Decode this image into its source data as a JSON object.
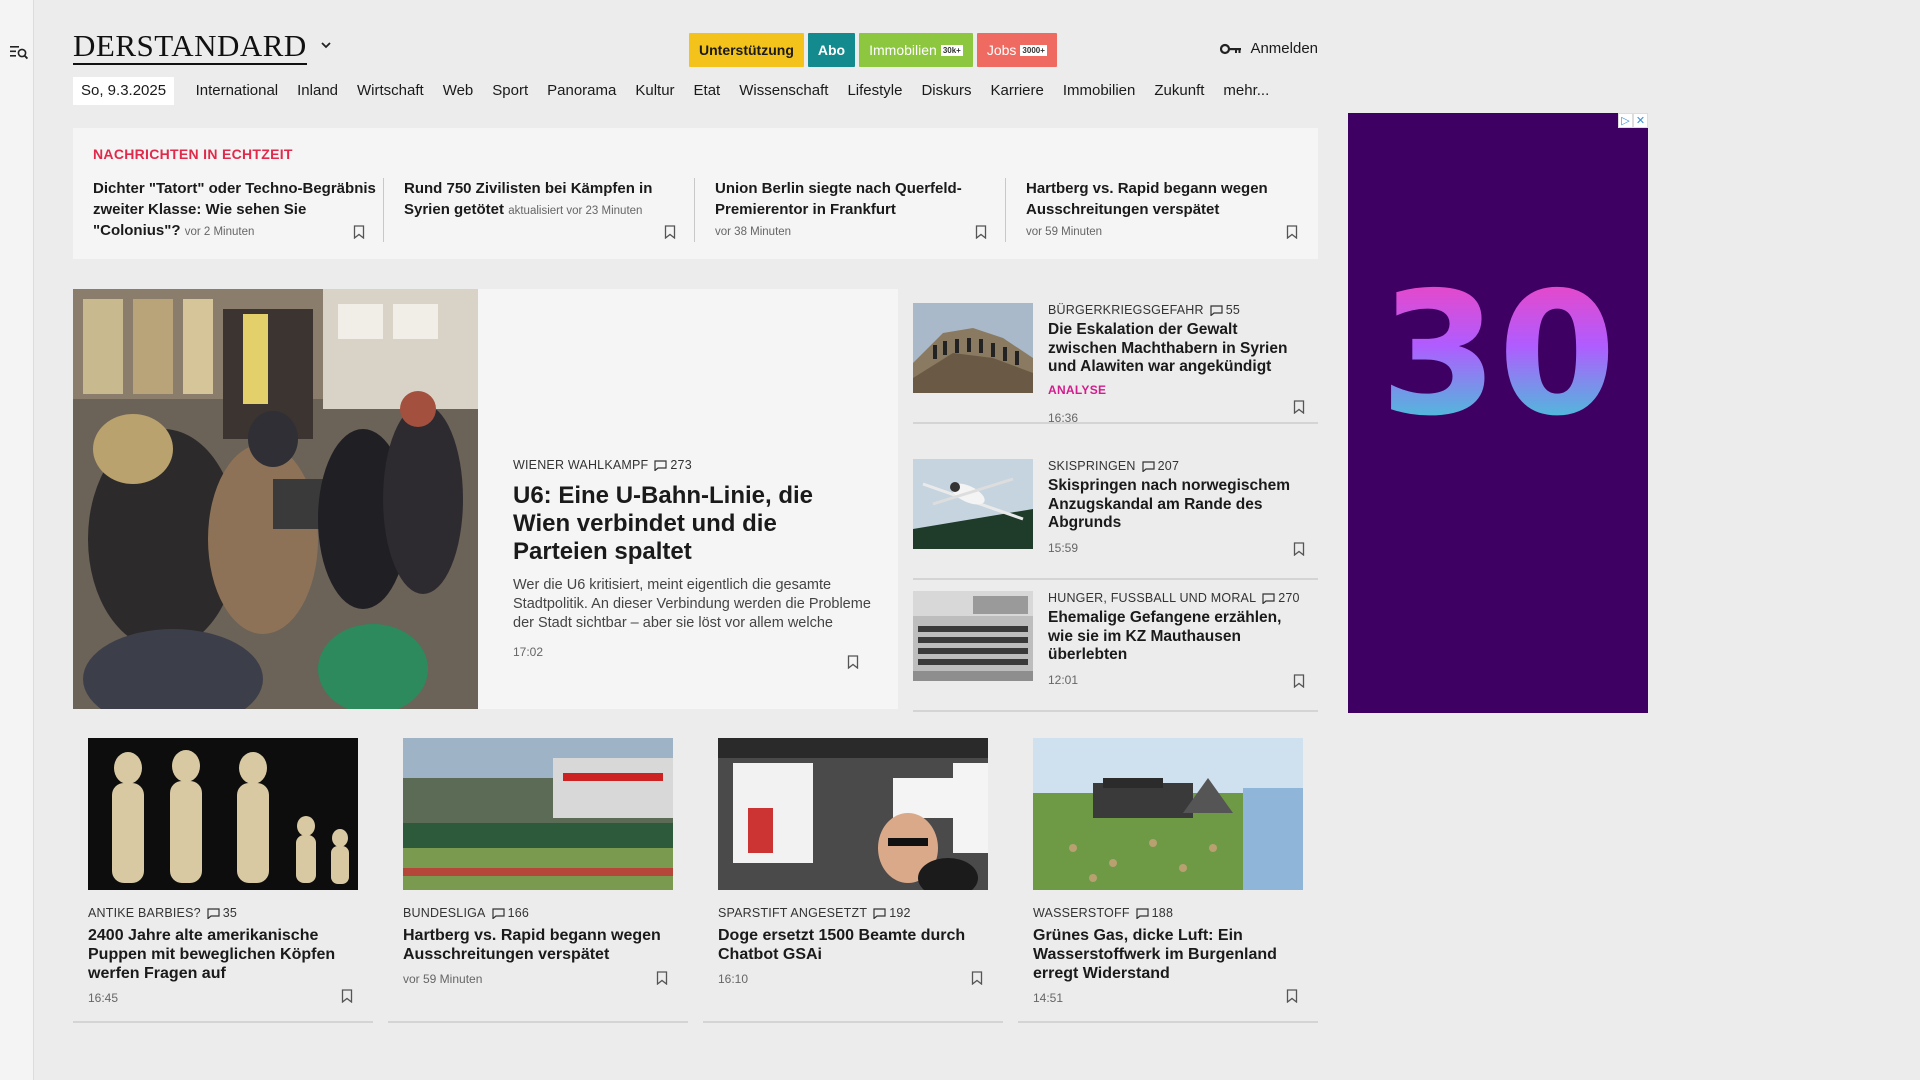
{
  "header": {
    "logo": "DERSTANDARD",
    "pills": {
      "unterstuetzung": "Unterstützung",
      "abo": "Abo",
      "immobilien": "Immobilien",
      "immobilien_tag": "30k+",
      "jobs": "Jobs",
      "jobs_tag": "3000+"
    },
    "login": "Anmelden"
  },
  "nav": {
    "date": "So, 9.3.2025",
    "items": [
      "International",
      "Inland",
      "Wirtschaft",
      "Web",
      "Sport",
      "Panorama",
      "Kultur",
      "Etat",
      "Wissenschaft",
      "Lifestyle",
      "Diskurs",
      "Karriere",
      "Immobilien",
      "Zukunft",
      "mehr..."
    ]
  },
  "ticker": {
    "label": "NACHRICHTEN IN ECHTZEIT",
    "items": [
      {
        "title": "Dichter \"Tatort\" oder Techno-Begräbnis zweiter Klasse: Wie sehen Sie \"Colonius\"?",
        "meta": "vor 2 Minuten"
      },
      {
        "title": "Rund 750 Zivilisten bei Kämpfen in Syrien getötet",
        "meta": "aktualisiert vor 23 Minuten"
      },
      {
        "title": "Union Berlin siegte nach Querfeld-Premierentor in Frankfurt",
        "meta": "vor 38 Minuten"
      },
      {
        "title": "Hartberg vs. Rapid begann wegen Ausschreitungen verspätet",
        "meta": "vor 59 Minuten"
      }
    ]
  },
  "hero": {
    "kicker": "WIENER WAHLKAMPF",
    "comments": "273",
    "title": "U6: Eine U-Bahn-Linie, die Wien verbindet und die Parteien spaltet",
    "teaser": "Wer die U6 kritisiert, meint eigentlich die gesamte Stadtpolitik. An dieser Verbindung werden die Probleme der Stadt sichtbar – aber sie löst vor allem welche",
    "time": "17:02"
  },
  "side": [
    {
      "kicker": "BÜRGERKRIEGSGEFAHR",
      "comments": "55",
      "title": "Die Eskalation der Gewalt zwischen Machthabern in Syrien und Alawiten war angekündigt",
      "label": "ANALYSE",
      "time": "16:36"
    },
    {
      "kicker": "SKISPRINGEN",
      "comments": "207",
      "title": "Skispringen nach norwegischem Anzugskandal am Rande des Abgrunds",
      "label": "",
      "time": "15:59"
    },
    {
      "kicker": "HUNGER, FUSSBALL UND MORAL",
      "comments": "270",
      "title": "Ehemalige Gefangene erzählen, wie sie im KZ Mauthausen überlebten",
      "label": "",
      "time": "12:01"
    }
  ],
  "cards": [
    {
      "kicker": "ANTIKE BARBIES?",
      "comments": "35",
      "title": "2400 Jahre alte amerikanische Puppen mit beweglichen Köpfen werfen Fragen auf",
      "time": "16:45"
    },
    {
      "kicker": "BUNDESLIGA",
      "comments": "166",
      "title": "Hartberg vs. Rapid begann wegen Ausschreitungen verspätet",
      "time": "vor 59 Minuten"
    },
    {
      "kicker": "SPARSTIFT ANGESETZT",
      "comments": "192",
      "title": "Doge ersetzt 1500 Beamte durch Chatbot GSAi",
      "time": "16:10"
    },
    {
      "kicker": "WASSERSTOFF",
      "comments": "188",
      "title": "Grünes Gas, dicke Luft: Ein Wasserstoffwerk im Burgenland erregt Widerstand",
      "time": "14:51"
    }
  ],
  "ad": {
    "text": "30",
    "buttons": [
      "▷",
      "✕"
    ]
  },
  "colors": {
    "ticker_label": "#e0294b",
    "analyse": "#d11d8d",
    "abo": "#138a8d",
    "ad_bg": "#3f0064"
  }
}
